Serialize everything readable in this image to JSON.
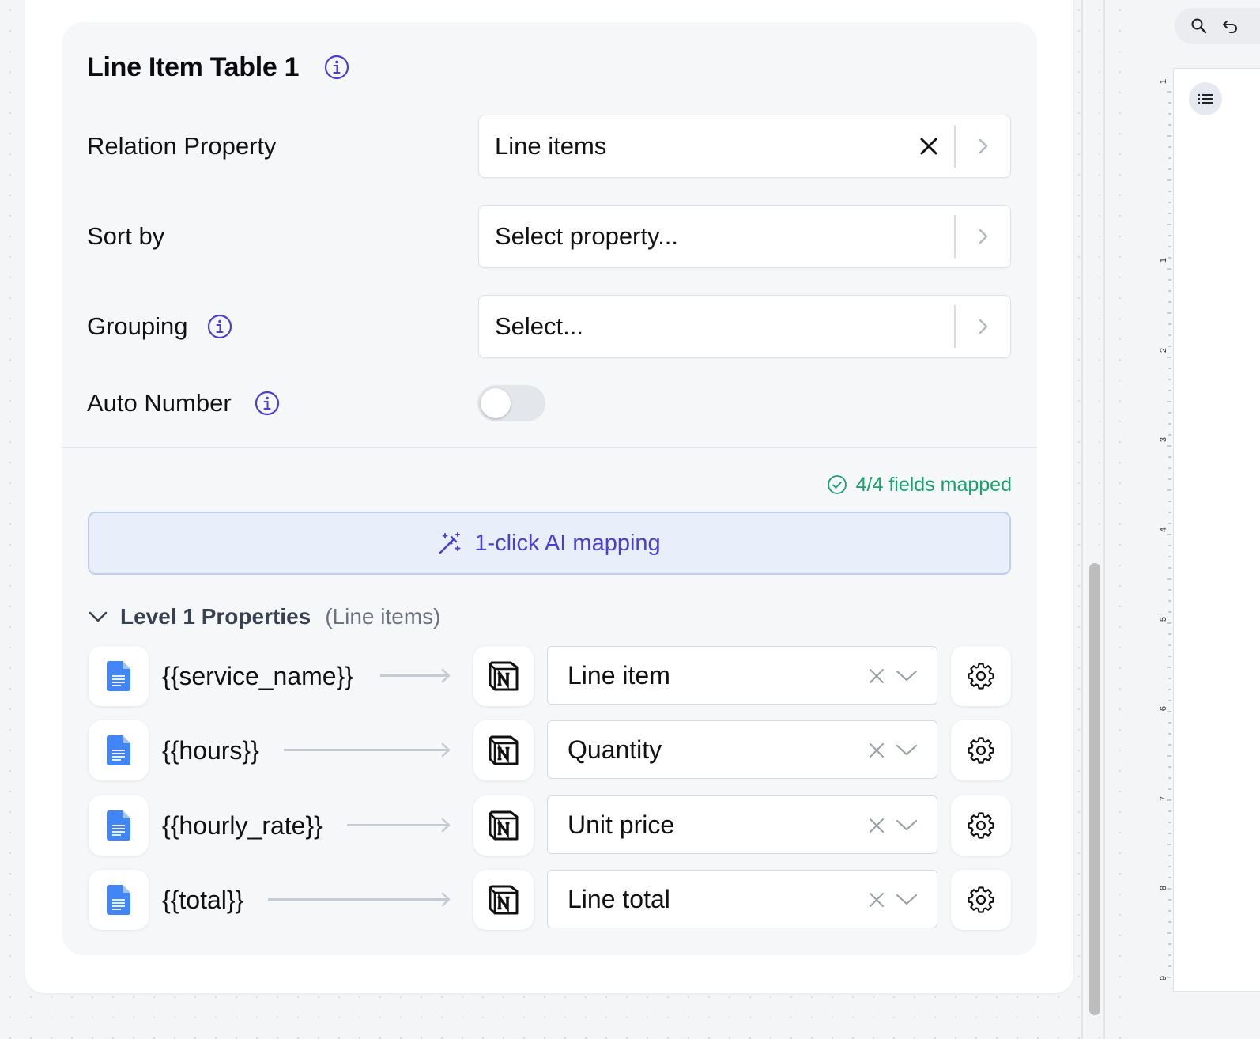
{
  "section": {
    "title": "Line Item Table 1"
  },
  "settings": {
    "relation_property": {
      "label": "Relation Property",
      "value": "Line items"
    },
    "sort_by": {
      "label": "Sort by",
      "value": "Select property..."
    },
    "grouping": {
      "label": "Grouping",
      "value": "Select..."
    },
    "auto_number": {
      "label": "Auto Number",
      "enabled": false
    }
  },
  "mapping": {
    "status": "4/4 fields mapped",
    "status_color": "#19a26b",
    "ai_button": "1-click AI mapping",
    "accent_color": "#4a3fd1",
    "level_title": "Level 1 Properties",
    "level_subtitle": "(Line items)",
    "rows": [
      {
        "placeholder": "{{service_name}}",
        "field": "Line item"
      },
      {
        "placeholder": "{{hours}}",
        "field": "Quantity"
      },
      {
        "placeholder": "{{hourly_rate}}",
        "field": "Unit price"
      },
      {
        "placeholder": "{{total}}",
        "field": "Line total"
      }
    ]
  },
  "right_panel": {
    "ruler_labels": [
      "1",
      "1",
      "2",
      "3",
      "4",
      "5",
      "6",
      "7",
      "8",
      "9"
    ]
  }
}
